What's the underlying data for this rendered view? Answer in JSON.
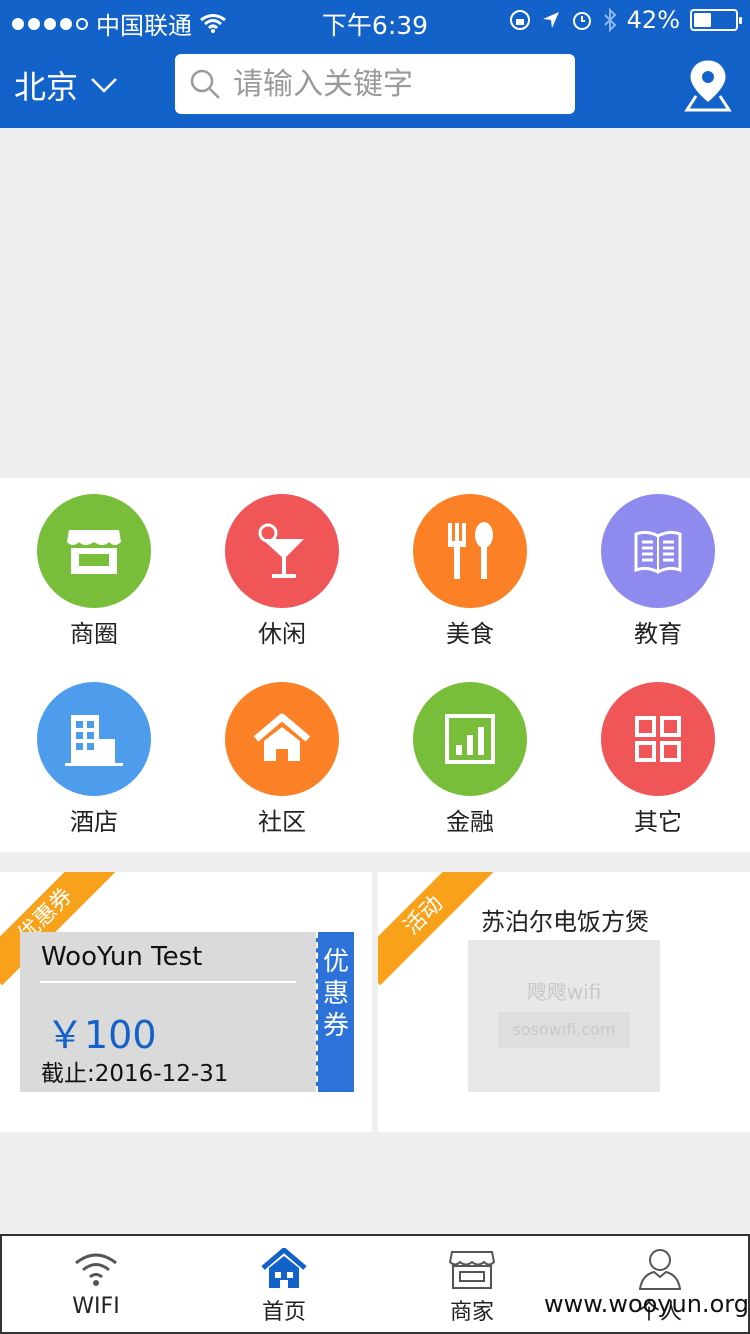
{
  "status": {
    "carrier": "中国联通",
    "time": "下午6:39",
    "battery": "42%",
    "battery_level": 0.42
  },
  "header": {
    "city": "北京",
    "search_placeholder": "请输入关键字"
  },
  "categories": [
    {
      "label": "商圈",
      "icon": "storefront-icon",
      "color": "#79be3b"
    },
    {
      "label": "休闲",
      "icon": "cocktail-icon",
      "color": "#f05658"
    },
    {
      "label": "美食",
      "icon": "fork-spoon-icon",
      "color": "#fc8126"
    },
    {
      "label": "教育",
      "icon": "book-icon",
      "color": "#8f8aed"
    },
    {
      "label": "酒店",
      "icon": "building-icon",
      "color": "#4e9cec"
    },
    {
      "label": "社区",
      "icon": "house-icon",
      "color": "#fc8126"
    },
    {
      "label": "金融",
      "icon": "bar-chart-icon",
      "color": "#79be3b"
    },
    {
      "label": "其它",
      "icon": "grid-icon",
      "color": "#f05658"
    }
  ],
  "coupon_card": {
    "ribbon": "优惠券",
    "title": "WooYun Test",
    "price": "￥100",
    "expiry": "截止:2016-12-31",
    "tab_label": "优惠券"
  },
  "activity_card": {
    "ribbon": "活动",
    "title": "苏泊尔电饭方煲",
    "image_text_1": "飕飕wifi",
    "image_text_2": "sosowifi.com"
  },
  "tabbar": [
    {
      "label": "WIFI",
      "icon": "wifi-icon",
      "active": false
    },
    {
      "label": "首页",
      "icon": "home-icon",
      "active": true
    },
    {
      "label": "商家",
      "icon": "shop-icon",
      "active": false
    },
    {
      "label": "个人",
      "icon": "person-icon",
      "active": false
    }
  ],
  "watermark": "www.wooyun.org",
  "colors": {
    "brand_blue": "#1262c9",
    "ribbon_orange": "#f8a21b",
    "coupon_tab_blue": "#2d72d8"
  }
}
